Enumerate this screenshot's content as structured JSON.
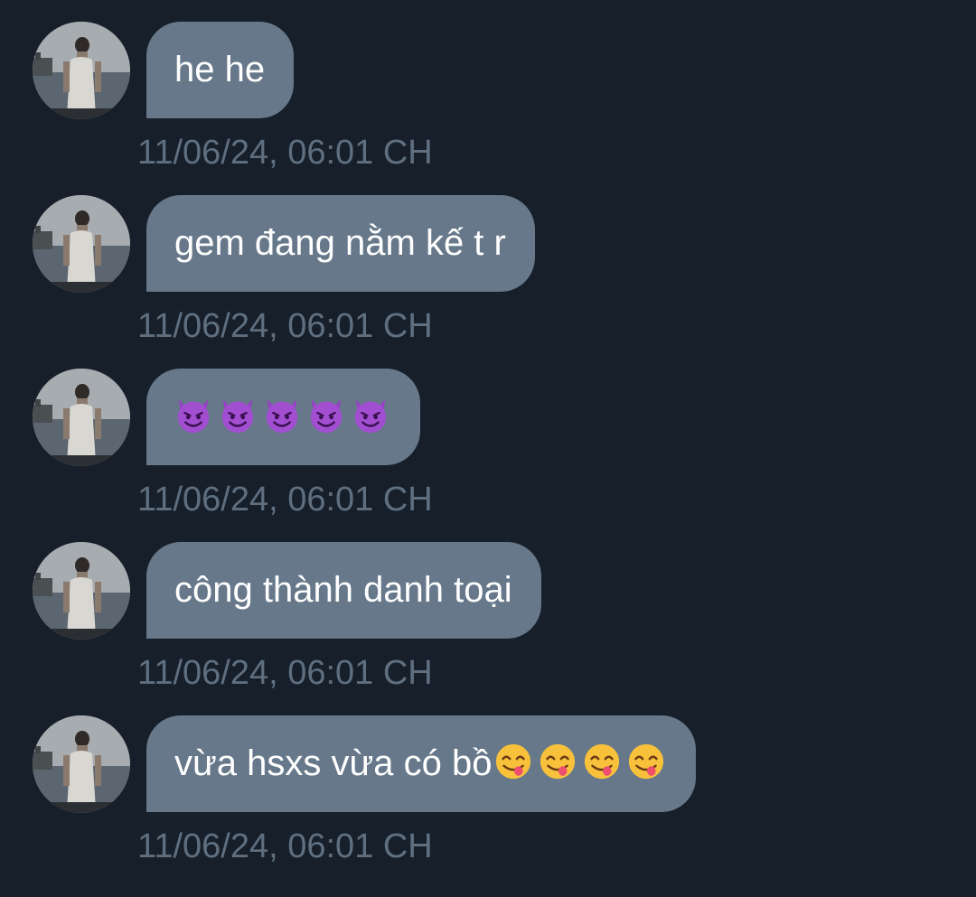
{
  "messages": [
    {
      "text": "he he",
      "emojis": [],
      "timestamp": "11/06/24, 06:01 CH"
    },
    {
      "text": "gem đang nằm kế t r",
      "emojis": [],
      "timestamp": "11/06/24, 06:01 CH"
    },
    {
      "text": "",
      "emojis": [
        "smiling-face-with-horns",
        "smiling-face-with-horns",
        "smiling-face-with-horns",
        "smiling-face-with-horns",
        "smiling-face-with-horns"
      ],
      "timestamp": "11/06/24, 06:01 CH"
    },
    {
      "text": "công thành danh toại",
      "emojis": [],
      "timestamp": "11/06/24, 06:01 CH"
    },
    {
      "text": "vừa hsxs vừa có bồ",
      "emojis": [
        "face-savoring-food",
        "face-savoring-food",
        "face-savoring-food",
        "face-savoring-food"
      ],
      "timestamp": "11/06/24, 06:01 CH"
    }
  ],
  "colors": {
    "background": "#161f2a",
    "bubble": "#66788a",
    "bubble_text": "#ffffff",
    "timestamp": "#5f6f80"
  }
}
